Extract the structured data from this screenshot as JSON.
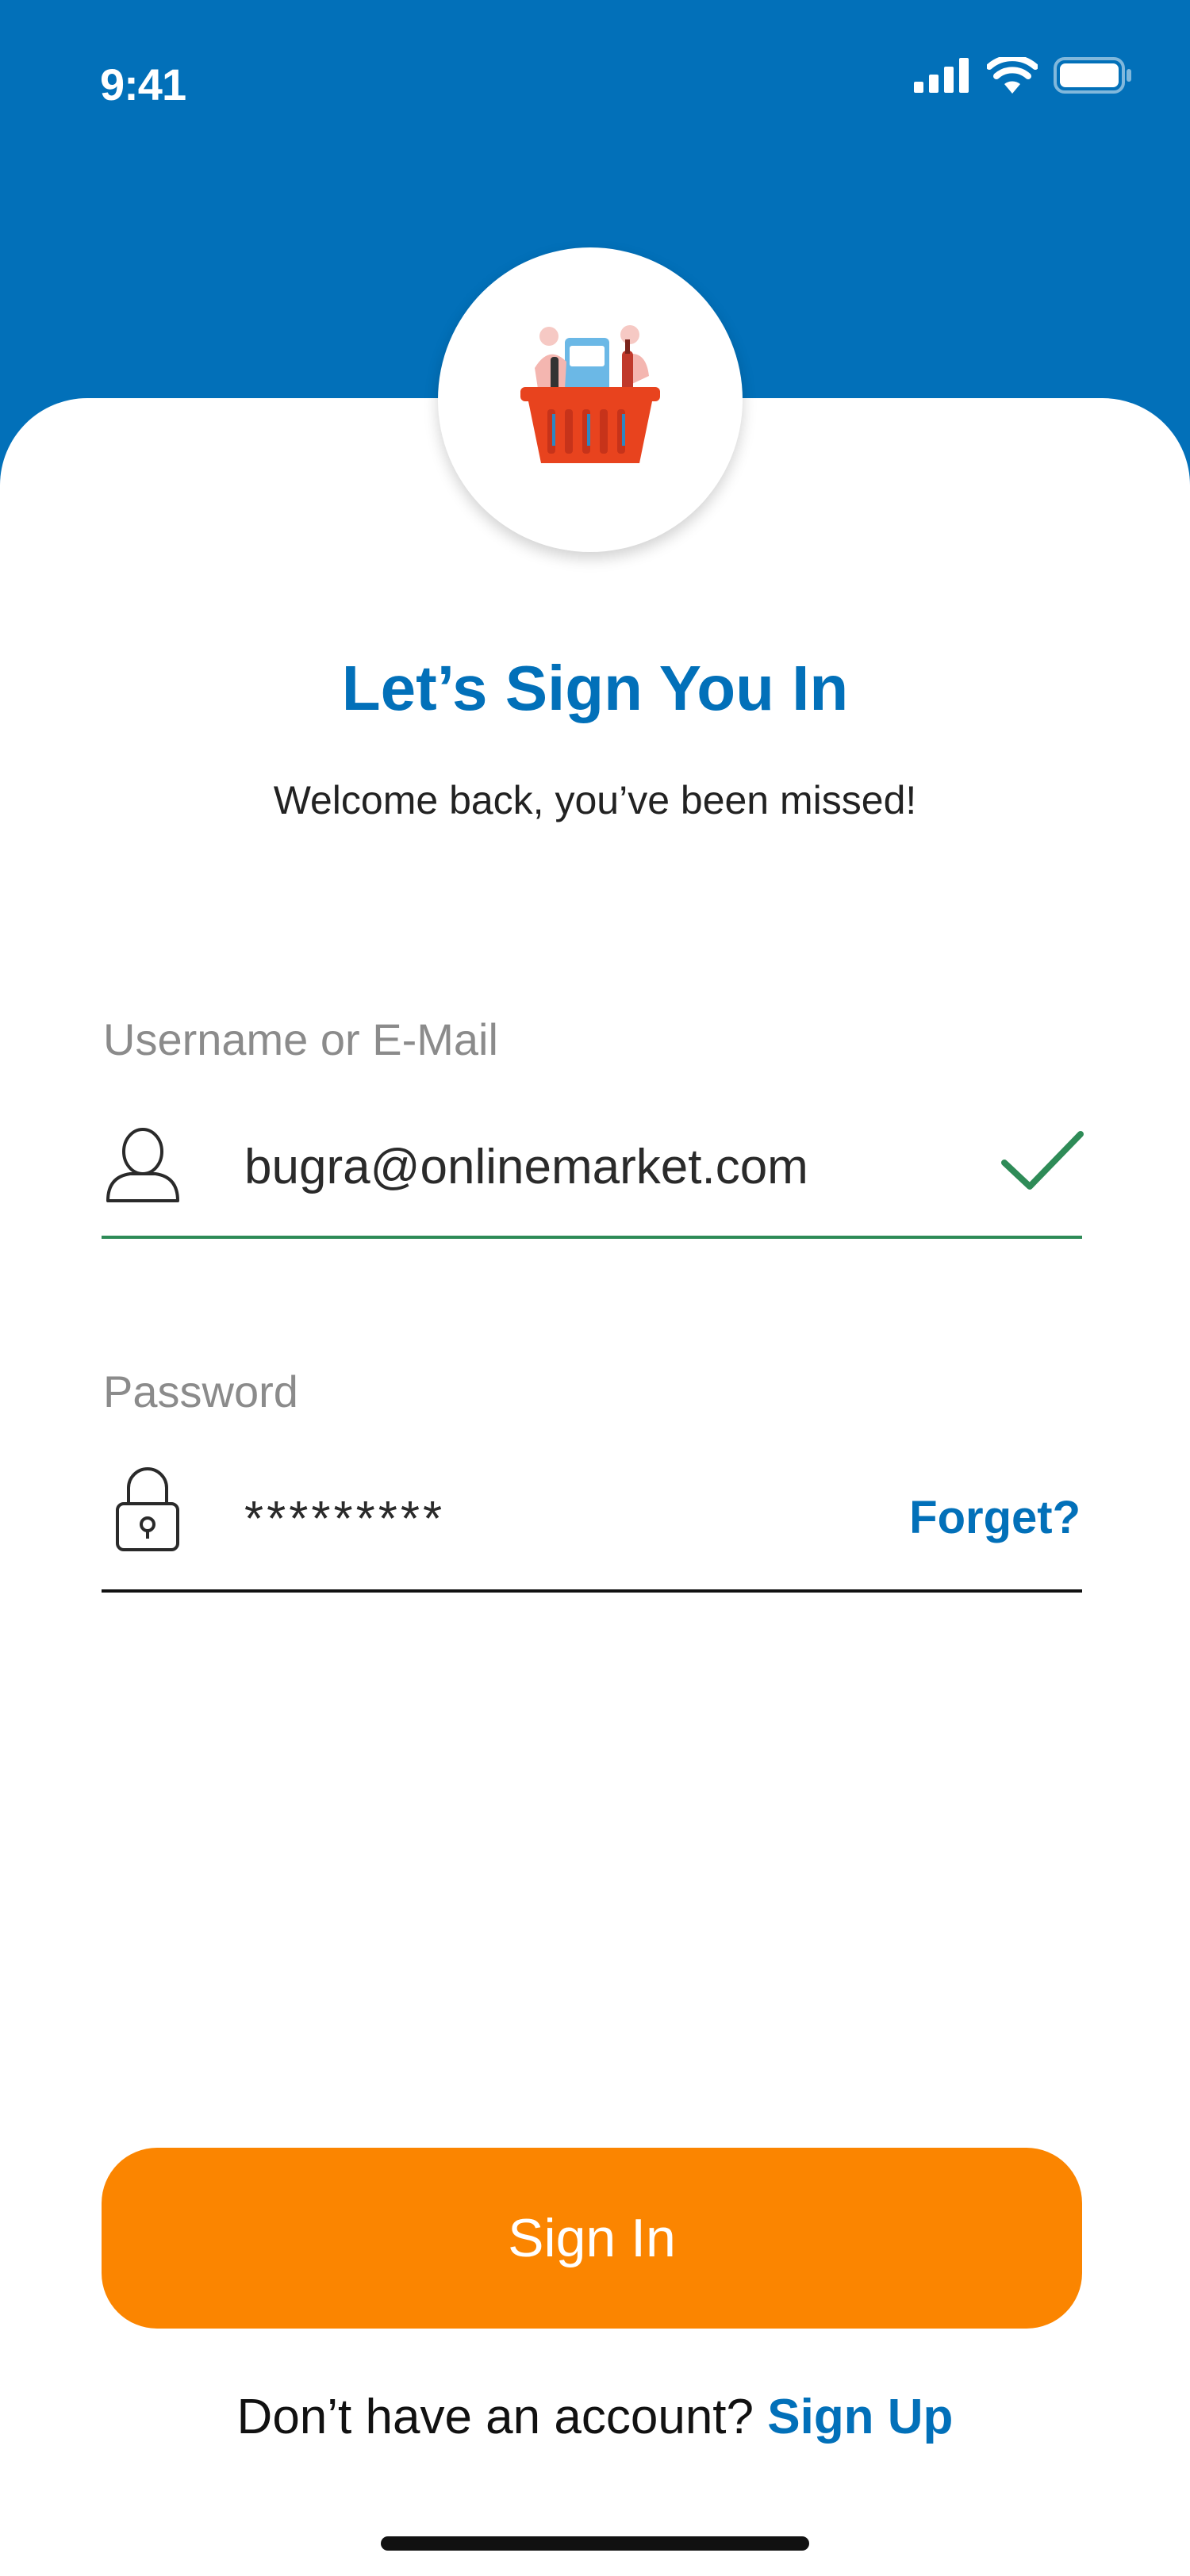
{
  "status_bar": {
    "time": "9:41",
    "icons": [
      "cellular-signal-icon",
      "wifi-icon",
      "battery-icon"
    ]
  },
  "logo": {
    "icon": "shopping-basket-icon"
  },
  "heading": {
    "title": "Let’s Sign You In",
    "subtitle": "Welcome back, you’ve been missed!"
  },
  "username": {
    "label": "Username or E-Mail",
    "value": "bugra@onlinemarket.com",
    "icon": "user-icon",
    "status_icon": "checkmark-icon",
    "valid": true
  },
  "password": {
    "label": "Password",
    "value": "*********",
    "icon": "lock-icon",
    "forget_label": "Forget?"
  },
  "actions": {
    "sign_in_label": "Sign In",
    "signup_prompt": "Don’t have an account? ",
    "signup_link": "Sign Up"
  },
  "colors": {
    "primary": "#0270B9",
    "accent": "#FB8500",
    "valid": "#2E8B57"
  }
}
